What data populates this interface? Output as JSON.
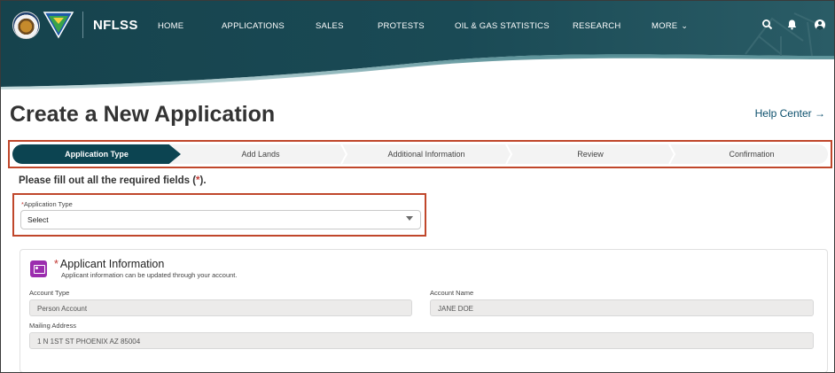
{
  "header": {
    "brand": "NFLSS",
    "nav": [
      "HOME",
      "APPLICATIONS",
      "SALES",
      "PROTESTS",
      "OIL & GAS STATISTICS",
      "RESEARCH",
      "MORE"
    ],
    "colors": {
      "navbar": "#16434d",
      "accent": "#0c4451",
      "highlight": "#c0472b"
    },
    "icons": [
      "search-icon",
      "bell-icon",
      "user-avatar-icon"
    ]
  },
  "page": {
    "title": "Create a New Application",
    "help_link": "Help Center →"
  },
  "path": {
    "steps": [
      "Application Type",
      "Add Lands",
      "Additional Information",
      "Review",
      "Confirmation"
    ],
    "active_index": 0
  },
  "form": {
    "instructions_pre": "Please fill out all the required fields (",
    "instructions_star": "*",
    "instructions_post": ").",
    "application_type": {
      "star": "*",
      "label": "Application Type",
      "value": "Select"
    }
  },
  "applicant": {
    "star": "*",
    "title": "Applicant Information",
    "subtitle": "Applicant information can be updated through your account.",
    "account_type_label": "Account Type",
    "account_type_value": "Person Account",
    "account_name_label": "Account Name",
    "account_name_value": "JANE DOE",
    "mailing_address_label": "Mailing Address",
    "mailing_address_value": "1 N 1ST ST PHOENIX AZ 85004"
  }
}
